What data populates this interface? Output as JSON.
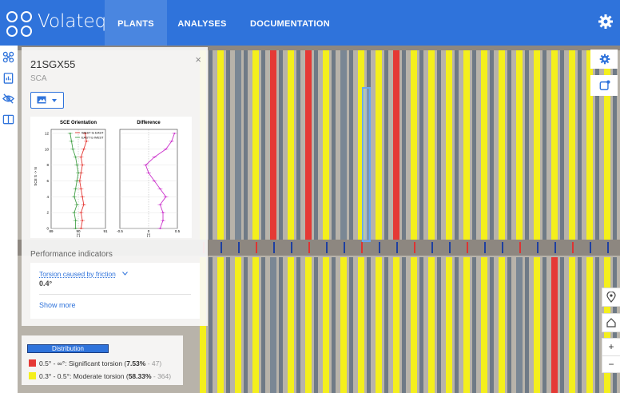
{
  "app": {
    "brand": "Volateq"
  },
  "nav": [
    {
      "label": "PLANTS",
      "active": true
    },
    {
      "label": "ANALYSES",
      "active": false
    },
    {
      "label": "DOCUMENTATION",
      "active": false
    }
  ],
  "panel": {
    "title": "21SGX55",
    "subtitle": "SCA",
    "close": "×",
    "chart": {
      "left_title": "SCE Orientation",
      "right_title": "Difference",
      "left_ylabel": "SCE S -> N",
      "left_xlabel": "[°]",
      "right_xlabel": "[°]",
      "left_legend": [
        "WEST to EAST",
        "EAST to WEST"
      ],
      "yticks": [
        "12",
        "10",
        "8",
        "6",
        "4",
        "2",
        "0"
      ],
      "left_xticks": [
        "89",
        "90",
        "91"
      ],
      "right_xticks": [
        "-0.5",
        "0",
        "0.5"
      ]
    },
    "perf_title": "Performance indicators",
    "kpi": {
      "label": "Torsion caused by friction",
      "value": "0.4°"
    },
    "show_more": "Show more"
  },
  "legend": {
    "title": "Distribution",
    "rows": [
      {
        "range": "0.5° - ∞°: Significant torsion (",
        "pct": "7.53%",
        "count": " - 47)",
        "color": "#e53935"
      },
      {
        "range": "0.3° - 0.5°: Moderate torsion (",
        "pct": "58.33%",
        "count": " - 364)",
        "color": "#f4ef1c"
      }
    ]
  },
  "chart_data": [
    {
      "type": "line",
      "title": "SCE Orientation",
      "xlabel": "[°]",
      "ylabel": "SCE S -> N",
      "xlim": [
        89,
        91
      ],
      "ylim": [
        0,
        12.5
      ],
      "series": [
        {
          "name": "WEST to EAST",
          "x": [
            90.1,
            90.15,
            90.1,
            90.2,
            90.15,
            90.1,
            90.05,
            90.1,
            90.15,
            90.1,
            90.2,
            90.3,
            90.25
          ],
          "y": [
            0,
            1,
            2,
            3,
            4,
            5,
            6,
            7,
            8,
            9,
            10,
            11,
            12
          ]
        },
        {
          "name": "EAST to WEST",
          "x": [
            89.9,
            89.9,
            89.85,
            89.95,
            89.85,
            89.9,
            89.95,
            90.0,
            89.95,
            89.9,
            89.8,
            89.75,
            89.7
          ],
          "y": [
            0,
            1,
            2,
            3,
            4,
            5,
            6,
            7,
            8,
            9,
            10,
            11,
            12
          ]
        }
      ],
      "colors": [
        "#e53935",
        "#43a047"
      ]
    },
    {
      "type": "line",
      "title": "Difference",
      "xlabel": "[°]",
      "xlim": [
        -0.5,
        0.5
      ],
      "ylim": [
        0,
        12.5
      ],
      "series": [
        {
          "x": [
            0.2,
            0.25,
            0.25,
            0.2,
            0.3,
            0.2,
            0.1,
            0.0,
            -0.05,
            0.1,
            0.3,
            0.4,
            0.45
          ],
          "y": [
            0,
            1,
            2,
            3,
            4,
            5,
            6,
            7,
            8,
            9,
            10,
            11,
            12
          ]
        }
      ],
      "colors": [
        "#cc33cc"
      ]
    }
  ]
}
